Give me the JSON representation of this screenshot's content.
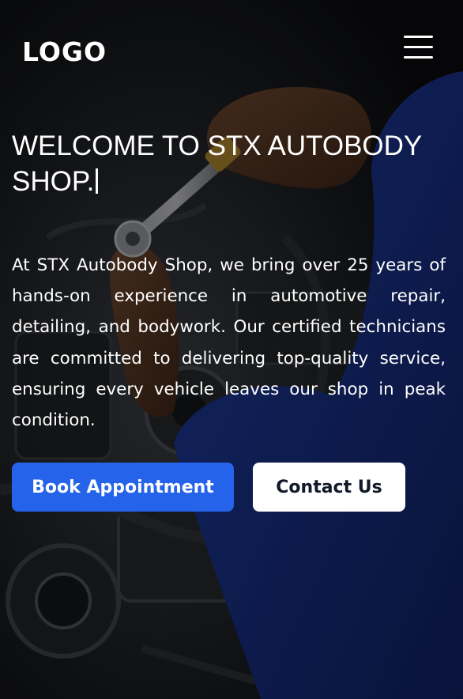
{
  "header": {
    "logo": "LOGO",
    "menu_icon": "hamburger-menu-icon"
  },
  "hero": {
    "title": "WELCOME TO STX AUTOBODY SHOP.",
    "description": "At STX Autobody Shop, we bring over 25 years of hands-on experience in automotive repair, detailing, and bodywork. Our certified technicians are committed to delivering top-quality service, ensuring every vehicle leaves our shop in peak condition.",
    "primary_button": "Book Appointment",
    "secondary_button": "Contact Us",
    "background_image": "mechanic-working-on-car-engine"
  },
  "colors": {
    "primary": "#2563eb",
    "secondary_bg": "#ffffff",
    "secondary_text": "#111827",
    "overlay": "#000000",
    "sleeve_blue": "#1f3fa8"
  }
}
